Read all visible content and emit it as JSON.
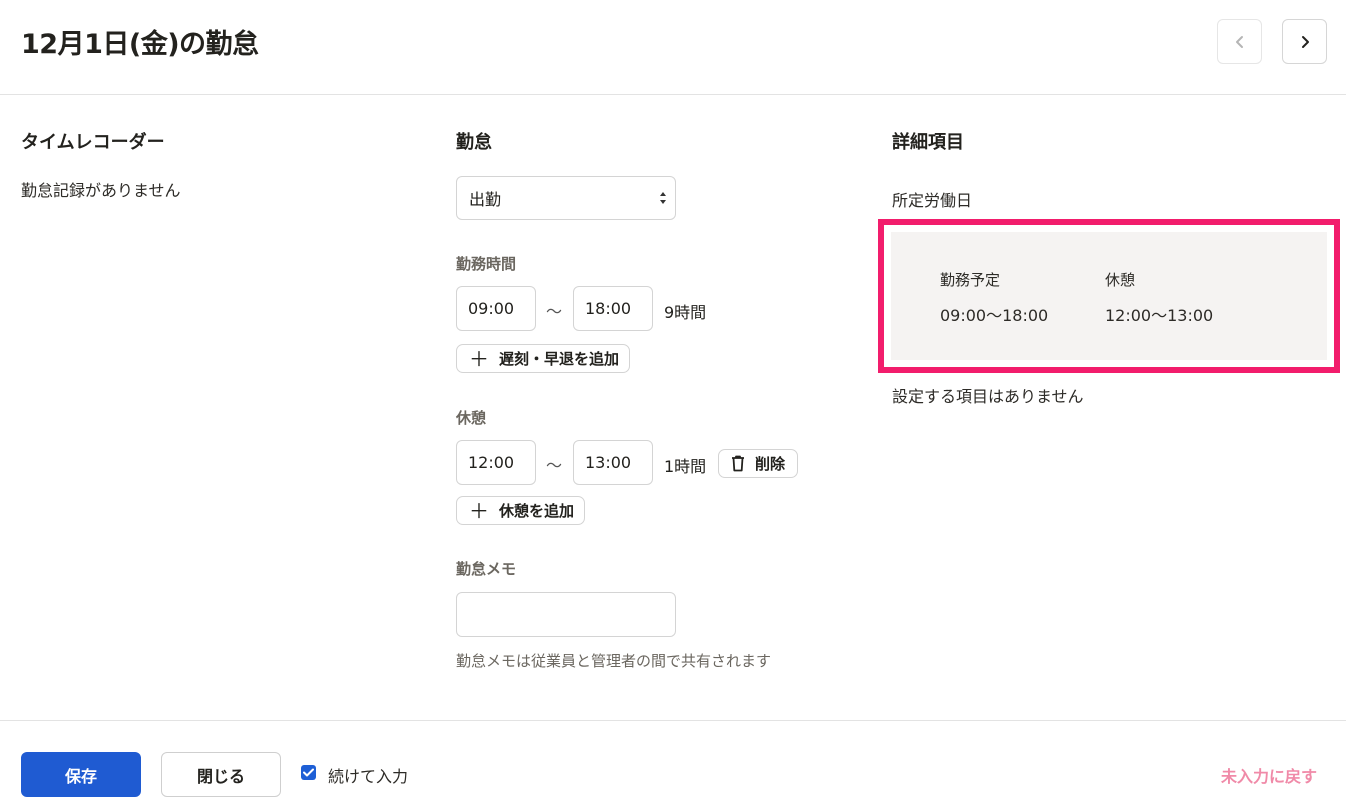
{
  "header": {
    "title": "12月1日(金)の勤怠",
    "prev_icon": "chevron-left-icon",
    "next_icon": "chevron-right-icon"
  },
  "time_recorder": {
    "title": "タイムレコーダー",
    "empty_text": "勤怠記録がありません"
  },
  "attendance": {
    "title": "勤怠",
    "type_selected": "出勤",
    "work_time": {
      "label": "勤務時間",
      "start": "09:00",
      "separator": "〜",
      "end": "18:00",
      "duration": "9時間",
      "add_label": "遅刻・早退を追加"
    },
    "break": {
      "label": "休憩",
      "start": "12:00",
      "separator": "〜",
      "end": "13:00",
      "duration": "1時間",
      "delete_label": "削除",
      "add_label": "休憩を追加"
    },
    "memo": {
      "label": "勤怠メモ",
      "value": "",
      "note": "勤怠メモは従業員と管理者の間で共有されます"
    }
  },
  "details": {
    "title": "詳細項目",
    "day_type": "所定労働日",
    "schedule": {
      "work_label": "勤務予定",
      "work_value": "09:00〜18:00",
      "break_label": "休憩",
      "break_value": "12:00〜13:00"
    },
    "no_items": "設定する項目はありません"
  },
  "footer": {
    "save_label": "保存",
    "close_label": "閉じる",
    "continue_label": "続けて入力",
    "continue_checked": true,
    "reset_label": "未入力に戻す"
  },
  "colors": {
    "primary": "#1f5bd2",
    "highlight_border": "#f21d6c",
    "reset_text": "#f08aa8"
  }
}
